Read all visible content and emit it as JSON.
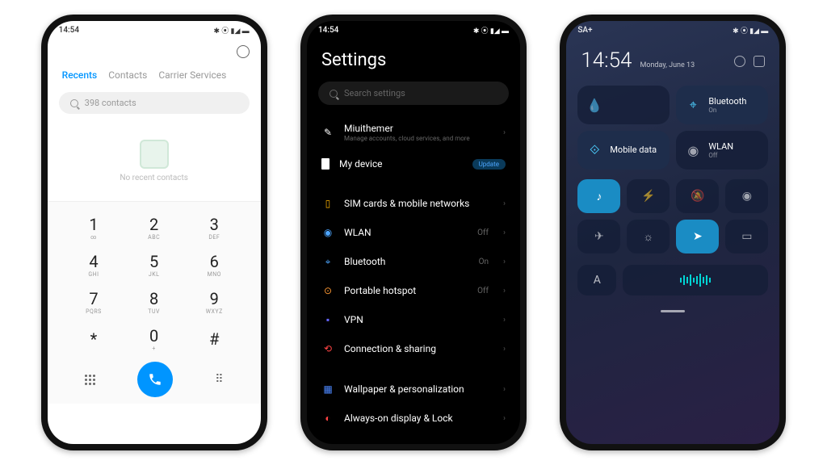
{
  "phone1": {
    "status_time": "14:54",
    "tabs": [
      "Recents",
      "Contacts",
      "Carrier Services"
    ],
    "search_placeholder": "398 contacts",
    "empty_text": "No recent contacts",
    "dialpad": [
      [
        {
          "n": "1",
          "s": "∞"
        },
        {
          "n": "2",
          "s": "ABC"
        },
        {
          "n": "3",
          "s": "DEF"
        }
      ],
      [
        {
          "n": "4",
          "s": "GHI"
        },
        {
          "n": "5",
          "s": "JKL"
        },
        {
          "n": "6",
          "s": "MNO"
        }
      ],
      [
        {
          "n": "7",
          "s": "PQRS"
        },
        {
          "n": "8",
          "s": "TUV"
        },
        {
          "n": "9",
          "s": "WXYZ"
        }
      ],
      [
        {
          "n": "*",
          "s": ""
        },
        {
          "n": "0",
          "s": "+"
        },
        {
          "n": "#",
          "s": ""
        }
      ]
    ]
  },
  "phone2": {
    "status_time": "14:54",
    "title": "Settings",
    "search_placeholder": "Search settings",
    "account": {
      "name": "Miuithemer",
      "sub": "Manage accounts, cloud services, and more"
    },
    "device": {
      "label": "My device",
      "badge": "Update"
    },
    "items": [
      {
        "icon": "sim",
        "label": "SIM cards & mobile networks",
        "right": ""
      },
      {
        "icon": "wifi",
        "label": "WLAN",
        "right": "Off"
      },
      {
        "icon": "bt",
        "label": "Bluetooth",
        "right": "On"
      },
      {
        "icon": "hotspot",
        "label": "Portable hotspot",
        "right": "Off"
      },
      {
        "icon": "vpn",
        "label": "VPN",
        "right": ""
      },
      {
        "icon": "share",
        "label": "Connection & sharing",
        "right": ""
      }
    ],
    "items2": [
      {
        "icon": "wallpaper",
        "label": "Wallpaper & personalization"
      },
      {
        "icon": "aod",
        "label": "Always-on display & Lock"
      }
    ]
  },
  "phone3": {
    "status_carrier": "SA+",
    "time": "14:54",
    "date": "Monday, June 13",
    "tiles": [
      {
        "icon": "water",
        "label": "",
        "sub": "",
        "active": false
      },
      {
        "icon": "bt",
        "label": "Bluetooth",
        "sub": "On",
        "active": true
      },
      {
        "icon": "data",
        "label": "Mobile data",
        "sub": "",
        "active": true
      },
      {
        "icon": "wifi",
        "label": "WLAN",
        "sub": "Off",
        "active": false
      }
    ],
    "small_tiles": [
      {
        "icon": "sound",
        "active": true
      },
      {
        "icon": "flash",
        "active": false
      },
      {
        "icon": "dnd",
        "active": false
      },
      {
        "icon": "camera",
        "active": false
      },
      {
        "icon": "plane",
        "active": false
      },
      {
        "icon": "bright",
        "active": false
      },
      {
        "icon": "location",
        "active": true
      },
      {
        "icon": "read",
        "active": false
      }
    ],
    "font_tile": "A"
  }
}
